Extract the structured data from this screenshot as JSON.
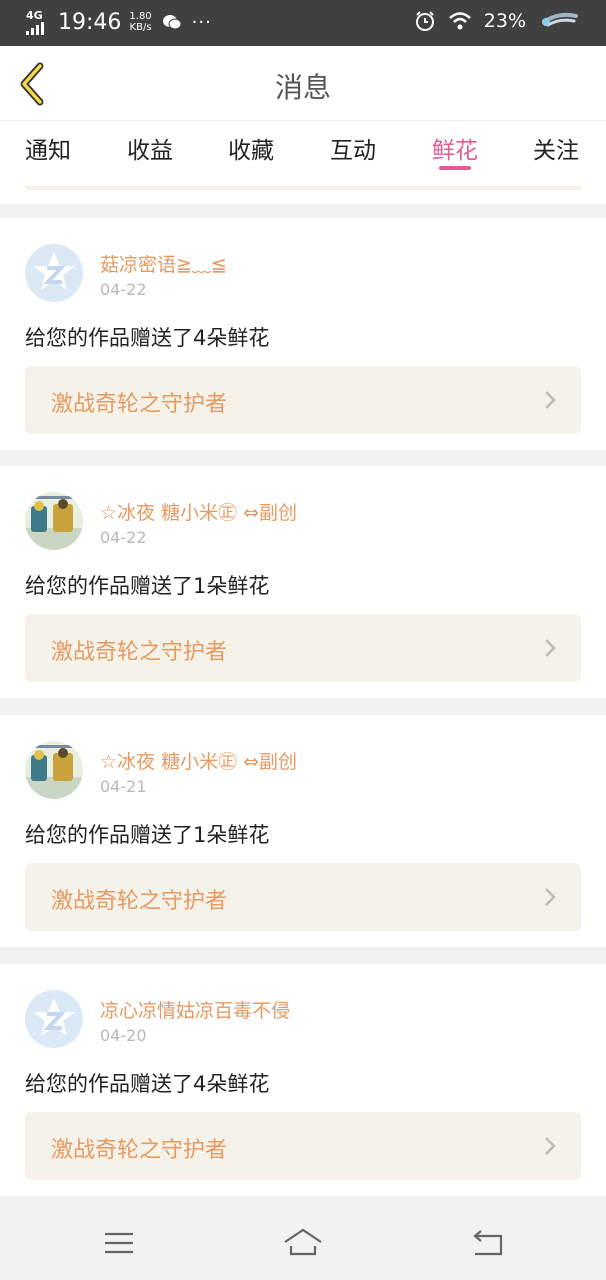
{
  "status_bar": {
    "network": "4G",
    "time": "19:46",
    "speed_value": "1.80",
    "speed_unit": "KB/s",
    "more": "···",
    "battery": "23%"
  },
  "header": {
    "title": "消息",
    "back_icon": "chevron-left-icon"
  },
  "tabs": [
    {
      "label": "通知",
      "active": false
    },
    {
      "label": "收益",
      "active": false
    },
    {
      "label": "收藏",
      "active": false
    },
    {
      "label": "互动",
      "active": false
    },
    {
      "label": "鲜花",
      "active": true
    },
    {
      "label": "关注",
      "active": false
    }
  ],
  "messages": [
    {
      "user": "菇凉密语≧﹏≦",
      "date": "04-22",
      "text": "给您的作品赠送了4朵鲜花",
      "work": "激战奇轮之守护者",
      "avatar": "default-avatar"
    },
    {
      "user": "☆冰夜 糖小米㊣ ⇔副创",
      "date": "04-22",
      "text": "给您的作品赠送了1朵鲜花",
      "work": "激战奇轮之守护者",
      "avatar": "photo-avatar"
    },
    {
      "user": "☆冰夜 糖小米㊣ ⇔副创",
      "date": "04-21",
      "text": "给您的作品赠送了1朵鲜花",
      "work": "激战奇轮之守护者",
      "avatar": "photo-avatar"
    },
    {
      "user": "凉心凉情姑凉百毒不侵",
      "date": "04-20",
      "text": "给您的作品赠送了4朵鲜花",
      "work": "激战奇轮之守护者",
      "avatar": "default-avatar"
    }
  ],
  "colors": {
    "accent": "#e45a93",
    "username": "#e59a62",
    "card_bg": "#f5f3e9"
  }
}
